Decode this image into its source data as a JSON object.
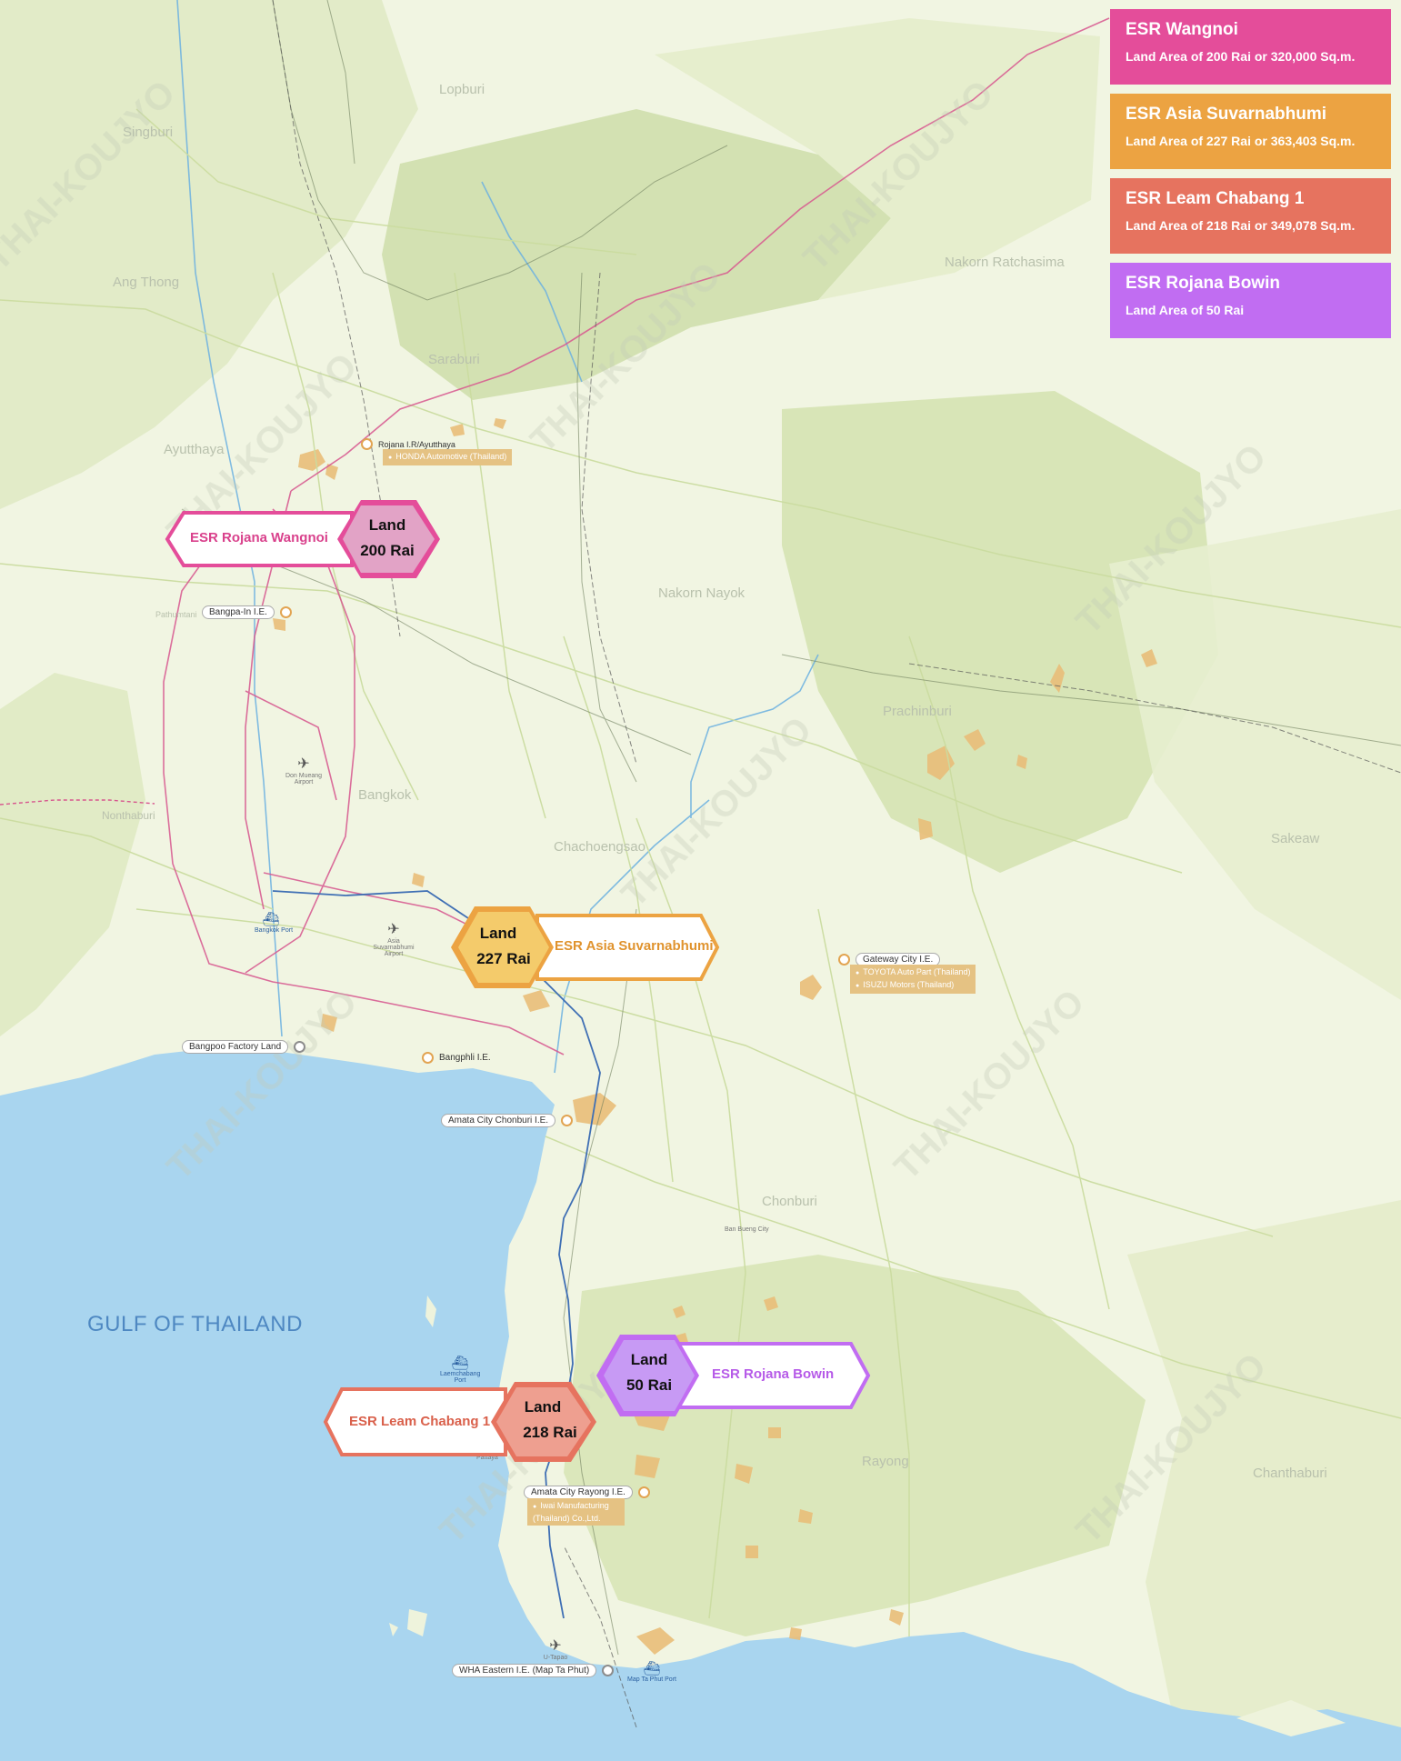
{
  "legend": [
    {
      "title": "ESR Wangnoi",
      "subtitle": "Land Area of 200 Rai or 320,000 Sq.m.",
      "color": "#e44d9a"
    },
    {
      "title": "ESR Asia Suvarnabhumi",
      "subtitle": "Land Area of 227 Rai or 363,403 Sq.m.",
      "color": "#eca342"
    },
    {
      "title": "ESR Leam Chabang 1",
      "subtitle": "Land Area of 218 Rai or 349,078 Sq.m.",
      "color": "#e6735f"
    },
    {
      "title": "ESR Rojana Bowin",
      "subtitle": "Land Area of 50 Rai",
      "color": "#c16df2"
    }
  ],
  "sites": {
    "wangnoi": {
      "name": "ESR Rojana Wangnoi",
      "land_label": "Land",
      "land_value": "200 Rai",
      "color": "#e44d9a"
    },
    "suvarnabhumi": {
      "name": "ESR Asia Suvarnabhumi",
      "land_label": "Land",
      "land_value": "227 Rai",
      "color": "#eca342"
    },
    "leam_chabang": {
      "name": "ESR Leam Chabang 1",
      "land_label": "Land",
      "land_value": "218 Rai",
      "color": "#e6735f"
    },
    "bowin": {
      "name": "ESR Rojana Bowin",
      "land_label": "Land",
      "land_value": "50 Rai",
      "color": "#c16df2"
    }
  },
  "regions": {
    "gulf": "GULF OF THAILAND",
    "provinces": [
      "Lopburi",
      "Singburi",
      "Ang Thong",
      "Saraburi",
      "Ayutthaya",
      "Nakorn Ratchasima",
      "Nakorn Nayok",
      "Prachinburi",
      "Bangkok",
      "Nonthaburi",
      "Chachoengsao",
      "Sakeaw",
      "Chonburi",
      "Rayong",
      "Chanthaburi",
      "Pathumtani"
    ]
  },
  "estates": {
    "rojana_ayutthaya": "Rojana I.R/Ayutthaya",
    "honda": "HONDA Automotive (Thailand)",
    "bangpain": "Bangpa-In I.E.",
    "gateway": "Gateway City I.E.",
    "toyota": "TOYOTA Auto Part (Thailand)",
    "isuzu": "ISUZU Motors (Thailand)",
    "bangpoo": "Bangpoo Factory Land",
    "bangphli": "Bangphli I.E.",
    "amata_chonburi": "Amata City Chonburi I.E.",
    "amata_rayong": "Amata City Rayong I.E.",
    "amata_rayong_tenant": "Iwai Manufacturing (Thailand) Co.,Ltd.",
    "wha_eastern": "WHA Eastern I.E. (Map Ta Phut)"
  },
  "airports": {
    "don_mueang": "Don Mueang Airport",
    "suvarnabhumi": "Asia Suvarnabhumi Airport",
    "u_tapao": "U-Tapao"
  },
  "ports": {
    "bangkok": "Bangkok Port",
    "laemchabang": "Laemchabang Port",
    "map_ta_phut": "Map Ta Phut Port"
  },
  "places": {
    "ban_bueng": "Ban Bueng City",
    "pattaya": "Pattaya"
  }
}
